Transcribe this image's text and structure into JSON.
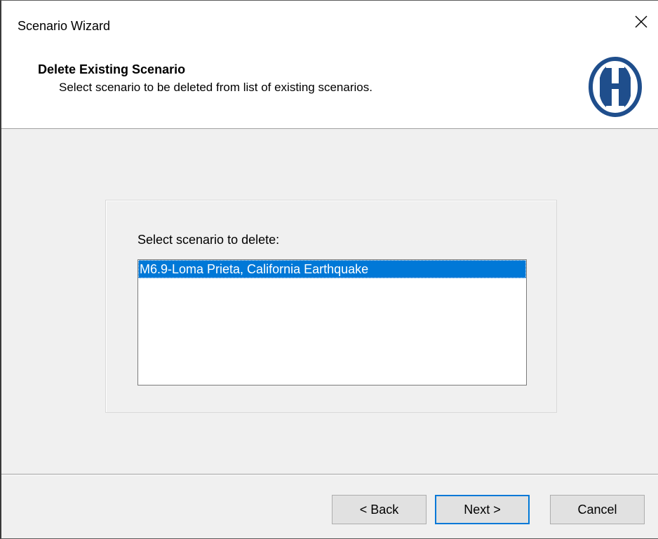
{
  "window": {
    "title": "Scenario Wizard"
  },
  "header": {
    "title": "Delete Existing Scenario",
    "subtitle": "Select scenario to be deleted from list of existing scenarios.",
    "logo_icon": "hazus-h-logo-icon",
    "logo_color": "#1f4e8c"
  },
  "content": {
    "label": "Select scenario to delete:",
    "scenarios": [
      {
        "label": "M6.9-Loma Prieta, California Earthquake",
        "selected": true
      }
    ],
    "selection_color": "#0078d7"
  },
  "footer": {
    "back_label": "< Back",
    "next_label": "Next >",
    "cancel_label": "Cancel"
  }
}
